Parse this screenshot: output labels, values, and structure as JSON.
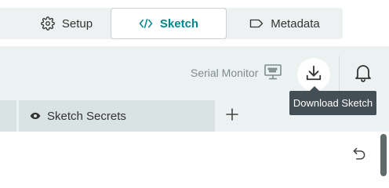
{
  "tabs": {
    "setup": {
      "label": "Setup",
      "icon": "gear-icon"
    },
    "sketch": {
      "label": "Sketch",
      "icon": "code-icon",
      "active": true
    },
    "metadata": {
      "label": "Metadata",
      "icon": "tag-icon"
    }
  },
  "toolbar": {
    "serial_monitor_label": "Serial Monitor",
    "serial_monitor_icon": "monitor-icon",
    "download_icon": "download-icon",
    "notifications_icon": "bell-icon",
    "tooltip": "Download Sketch"
  },
  "file_tabs": {
    "secrets": {
      "label": "Sketch Secrets",
      "icon": "eye-icon"
    },
    "add_icon": "plus-icon"
  },
  "editor": {
    "undo_icon": "undo-icon"
  },
  "colors": {
    "accent": "#00878f",
    "toolbar_bg": "#ecf1f1",
    "tooltip_bg": "#434f54"
  }
}
